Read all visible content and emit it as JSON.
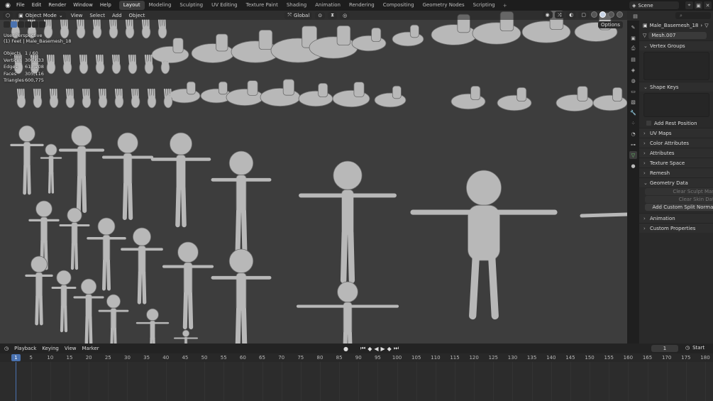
{
  "menubar": {
    "items": [
      "File",
      "Edit",
      "Render",
      "Window",
      "Help"
    ],
    "workspaces": [
      "Layout",
      "Modeling",
      "Sculpting",
      "UV Editing",
      "Texture Paint",
      "Shading",
      "Animation",
      "Rendering",
      "Compositing",
      "Geometry Nodes",
      "Scripting"
    ],
    "active_workspace": "Layout",
    "add_tab": "+",
    "scene_name": "Scene"
  },
  "viewport": {
    "mode": "Object Mode",
    "menus": [
      "View",
      "Select",
      "Add",
      "Object"
    ],
    "transform_orientation": "Global",
    "options_label": "Options",
    "perspective": "User Perspective",
    "collection_path": "(1) Feet | Male_Basemesh_18",
    "stats": [
      {
        "label": "Objects",
        "value": "1 / 60"
      },
      {
        "label": "Vertices",
        "value": "306,633"
      },
      {
        "label": "Edges",
        "value": "613,208"
      },
      {
        "label": "Faces",
        "value": "305,116"
      },
      {
        "label": "Triangles",
        "value": "600,775"
      }
    ]
  },
  "timeline": {
    "menus": [
      "Playback",
      "Keying",
      "View",
      "Marker"
    ],
    "current_frame": "1",
    "frame_field": "1",
    "start_label": "Start",
    "ticks": [
      "5",
      "10",
      "15",
      "20",
      "25",
      "30",
      "35",
      "40",
      "45",
      "50",
      "55",
      "60",
      "65",
      "70",
      "75",
      "80",
      "85",
      "90",
      "95",
      "100",
      "105",
      "110",
      "115",
      "120",
      "125",
      "130",
      "135",
      "140",
      "145",
      "150",
      "155",
      "160",
      "165",
      "170",
      "175",
      "180"
    ]
  },
  "properties": {
    "object_name": "Male_Basemesh_18",
    "mesh_name": "Mesh.007",
    "vertex_groups": "Vertex Groups",
    "shape_keys": "Shape Keys",
    "add_rest_position": "Add Rest Position",
    "collapsed_panels_a": [
      "UV Maps",
      "Color Attributes",
      "Attributes",
      "Texture Space",
      "Remesh"
    ],
    "geometry_data": "Geometry Data",
    "geometry_buttons": [
      "Clear Sculpt Mask",
      "Clear Skin Data",
      "Add Custom Split Normals"
    ],
    "collapsed_panels_b": [
      "Animation",
      "Custom Properties"
    ]
  },
  "colors": {
    "accent": "#4a72b0",
    "viewport_bg": "#3d3d3d",
    "mesh_fill": "#b8b8b8",
    "mesh_wire": "#6a6a6a"
  }
}
